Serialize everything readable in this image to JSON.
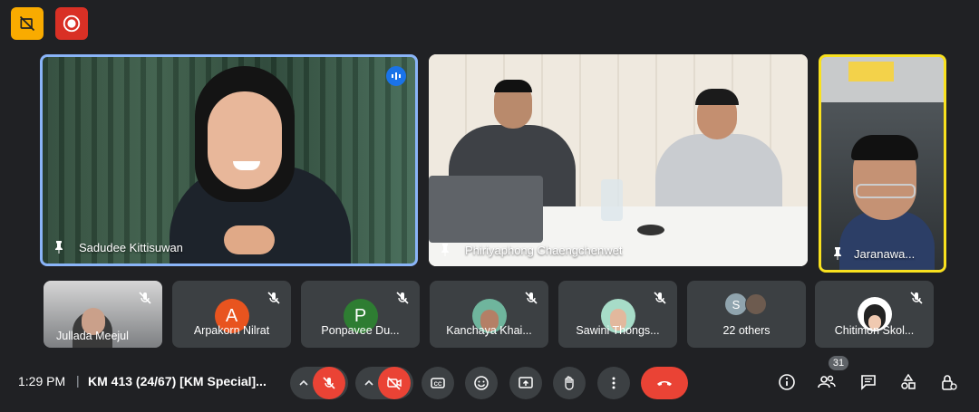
{
  "top": {
    "icons": [
      "hide-self-view-icon",
      "record-icon"
    ],
    "colors": {
      "self_view": "#f9ab00",
      "record": "#d93025"
    }
  },
  "main_tiles": [
    {
      "name": "Sadudee Kittisuwan",
      "speaking": true,
      "border": "#8ab4f8"
    },
    {
      "name": "Phiriyaphong Chaengchenwet",
      "speaking": false
    },
    {
      "name": "Jaranawa...",
      "speaking": false,
      "border": "#f9e11e"
    }
  ],
  "small_tiles": [
    {
      "name": "Jullada Meejul",
      "type": "video"
    },
    {
      "name": "Arpakorn Nilrat",
      "avatar_letter": "A",
      "avatar_color": "#e8541f"
    },
    {
      "name": "Ponpavee Du...",
      "avatar_letter": "P",
      "avatar_color": "#2e7d32"
    },
    {
      "name": "Kanchaya Khai...",
      "type": "photo"
    },
    {
      "name": "Sawini Thongs...",
      "type": "photo"
    },
    {
      "name": "22 others",
      "avatar_letter": "S",
      "avatar_color": "#90a4ae"
    },
    {
      "name": "Chitimon Skol...",
      "type": "photo"
    }
  ],
  "bottom": {
    "time": "1:29 PM",
    "separator": "|",
    "meeting": "KM 413 (24/67) [KM Special]...",
    "participant_count": "31",
    "end_call_color": "#ea4335",
    "muted_color": "#ea4335"
  }
}
